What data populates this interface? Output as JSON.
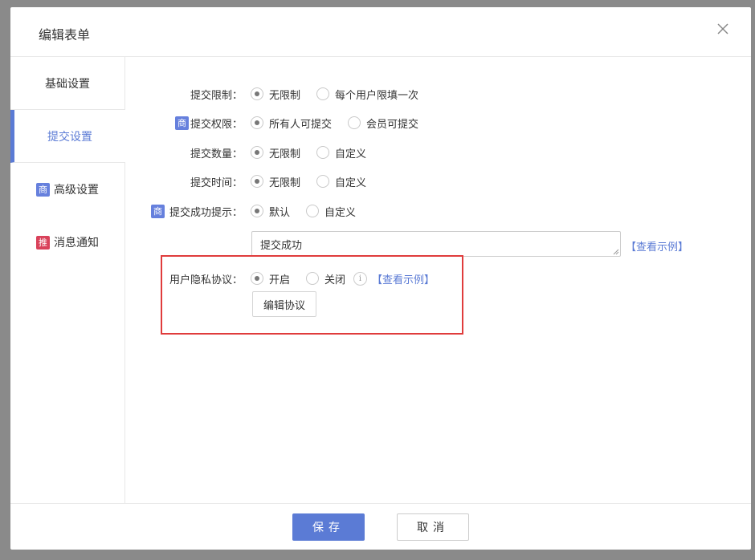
{
  "dialog": {
    "title": "编辑表单"
  },
  "sidebar": {
    "items": [
      {
        "label": "基础设置",
        "tag": ""
      },
      {
        "label": "提交设置",
        "tag": ""
      },
      {
        "label": "高级设置",
        "tag": "商"
      },
      {
        "label": "消息通知",
        "tag": "推"
      }
    ],
    "active_index": 1
  },
  "form": {
    "submit_limit": {
      "label": "提交限制：",
      "options": [
        "无限制",
        "每个用户限填一次"
      ],
      "selected": 0
    },
    "submit_permission": {
      "tag": "商",
      "label": "提交权限：",
      "options": [
        "所有人可提交",
        "会员可提交"
      ],
      "selected": 0
    },
    "submit_count": {
      "label": "提交数量：",
      "options": [
        "无限制",
        "自定义"
      ],
      "selected": 0
    },
    "submit_time": {
      "label": "提交时间：",
      "options": [
        "无限制",
        "自定义"
      ],
      "selected": 0
    },
    "success_tip": {
      "tag": "商",
      "label": "提交成功提示：",
      "options": [
        "默认",
        "自定义"
      ],
      "selected": 0,
      "text_value": "提交成功",
      "example_link": "【查看示例】"
    },
    "privacy": {
      "label": "用户隐私协议：",
      "options": [
        "开启",
        "关闭"
      ],
      "selected": 0,
      "info_icon": "i",
      "example_link": "【查看示例】",
      "edit_button": "编辑协议"
    }
  },
  "footer": {
    "save_label": "保存",
    "cancel_label": "取消"
  },
  "colors": {
    "accent": "#5b7bd5",
    "tag_blue": "#6680dd",
    "tag_red": "#d9415a",
    "highlight": "#e03c3c"
  }
}
